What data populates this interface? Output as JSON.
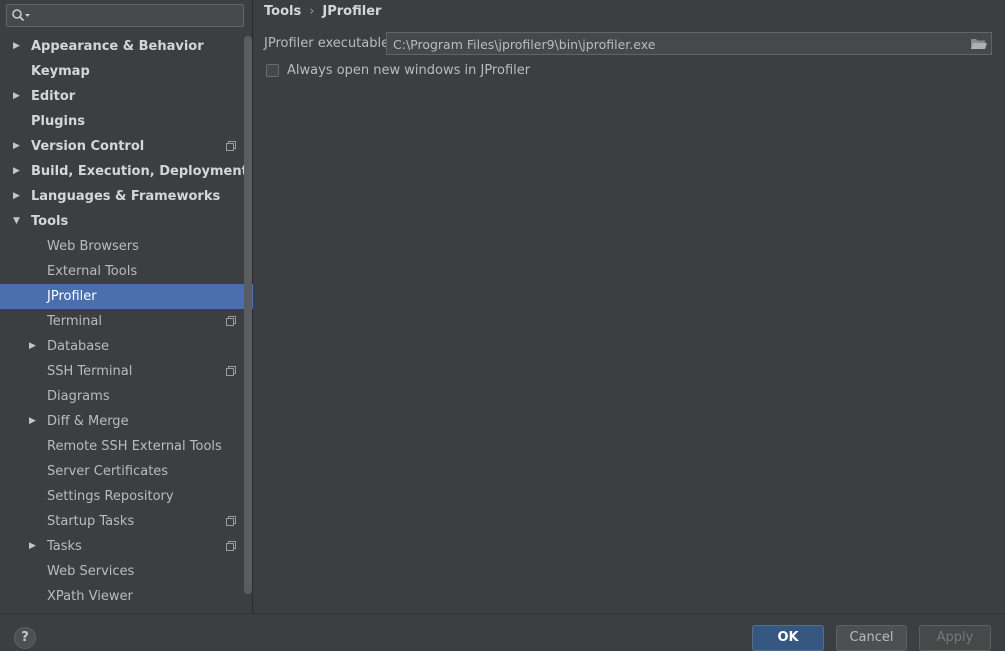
{
  "search": {
    "placeholder": ""
  },
  "tree": [
    {
      "label": "Appearance & Behavior",
      "level": 0,
      "arrow": "right",
      "copy": false
    },
    {
      "label": "Keymap",
      "level": 0,
      "arrow": "",
      "copy": false
    },
    {
      "label": "Editor",
      "level": 0,
      "arrow": "right",
      "copy": false
    },
    {
      "label": "Plugins",
      "level": 0,
      "arrow": "",
      "copy": false
    },
    {
      "label": "Version Control",
      "level": 0,
      "arrow": "right",
      "copy": true
    },
    {
      "label": "Build, Execution, Deployment",
      "level": 0,
      "arrow": "right",
      "copy": false
    },
    {
      "label": "Languages & Frameworks",
      "level": 0,
      "arrow": "right",
      "copy": false
    },
    {
      "label": "Tools",
      "level": 0,
      "arrow": "down",
      "copy": false
    },
    {
      "label": "Web Browsers",
      "level": 1,
      "arrow": "",
      "copy": false
    },
    {
      "label": "External Tools",
      "level": 1,
      "arrow": "",
      "copy": false
    },
    {
      "label": "JProfiler",
      "level": 1,
      "arrow": "",
      "copy": false,
      "selected": true
    },
    {
      "label": "Terminal",
      "level": 1,
      "arrow": "",
      "copy": true
    },
    {
      "label": "Database",
      "level": 1,
      "arrow": "right",
      "copy": false
    },
    {
      "label": "SSH Terminal",
      "level": 1,
      "arrow": "",
      "copy": true
    },
    {
      "label": "Diagrams",
      "level": 1,
      "arrow": "",
      "copy": false
    },
    {
      "label": "Diff & Merge",
      "level": 1,
      "arrow": "right",
      "copy": false
    },
    {
      "label": "Remote SSH External Tools",
      "level": 1,
      "arrow": "",
      "copy": false
    },
    {
      "label": "Server Certificates",
      "level": 1,
      "arrow": "",
      "copy": false
    },
    {
      "label": "Settings Repository",
      "level": 1,
      "arrow": "",
      "copy": false
    },
    {
      "label": "Startup Tasks",
      "level": 1,
      "arrow": "",
      "copy": true
    },
    {
      "label": "Tasks",
      "level": 1,
      "arrow": "right",
      "copy": true
    },
    {
      "label": "Web Services",
      "level": 1,
      "arrow": "",
      "copy": false
    },
    {
      "label": "XPath Viewer",
      "level": 1,
      "arrow": "",
      "copy": false
    }
  ],
  "breadcrumb": {
    "parent": "Tools",
    "separator": "›",
    "current": "JProfiler"
  },
  "settings": {
    "executable_label": "JProfiler executable:",
    "executable_value": "C:\\Program Files\\jprofiler9\\bin\\jprofiler.exe",
    "checkbox_label": "Always open new windows in JProfiler",
    "checkbox_checked": false
  },
  "footer": {
    "help": "?",
    "ok": "OK",
    "cancel": "Cancel",
    "apply": "Apply"
  },
  "colors": {
    "selection": "#4b6eaf",
    "background": "#3c3f41",
    "ok_button": "#365880"
  }
}
